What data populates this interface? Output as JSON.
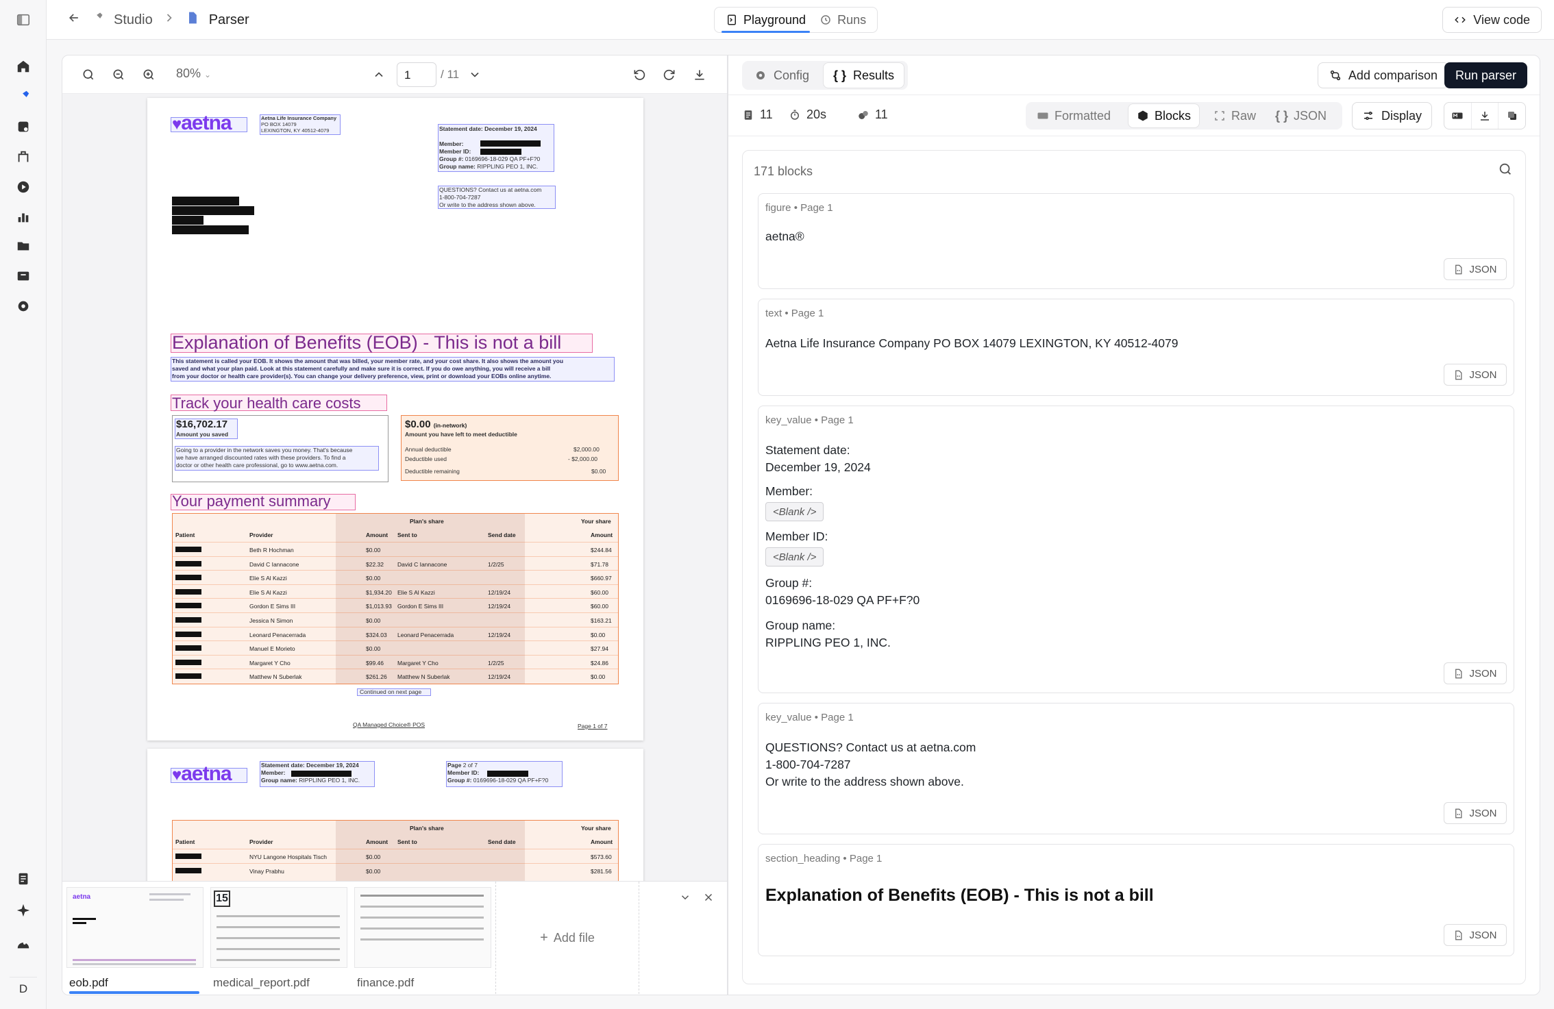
{
  "breadcrumb": {
    "studio": "Studio",
    "parser": "Parser"
  },
  "mode_tabs": {
    "playground": "Playground",
    "runs": "Runs"
  },
  "view_code": "View code",
  "rail": {
    "avatar": "D"
  },
  "doc_toolbar": {
    "zoom": "80%",
    "page_value": "1",
    "page_total": "/ 11"
  },
  "document": {
    "insurer": "Aetna Life Insurance Company",
    "address1": "PO BOX 14079",
    "address2": "LEXINGTON, KY 40512-4079",
    "statement_label": "Statement date:",
    "statement_date": "December 19, 2024",
    "member_label": "Member:",
    "member_id_label": "Member ID:",
    "group_label": "Group #:",
    "group_value": "0169696-18-029 QA PF+F?0",
    "group_name_label": "Group name:",
    "group_name_value": "RIPPLING PEO 1, INC.",
    "questions_1": "QUESTIONS? Contact us at aetna.com",
    "questions_2": "1-800-704-7287",
    "questions_3": "Or write to the address shown above.",
    "eob_title": "Explanation of Benefits (EOB) - This is not a bill",
    "eob_intro_1": "This statement is called your EOB. It shows the amount that was billed, your member rate, and your cost share. It also shows the amount you",
    "eob_intro_2": "saved and what your plan paid. Look at this statement carefully and make sure it is correct. If you do owe anything, you will receive a bill",
    "eob_intro_3": "from your doctor or health care provider(s). You can change your delivery preference, view, print or download your EOBs online anytime.",
    "track_title": "Track your health care costs",
    "saved_amount": "$16,702.17",
    "saved_label": "Amount you saved",
    "saved_note_1": "Going to a provider in the network saves you money. That's because",
    "saved_note_2": "we have arranged discounted rates with these providers. To find a",
    "saved_note_3": "doctor or other health care professional, go to www.aetna.com.",
    "deductible_amount": "$0.00",
    "deductible_in_network": "(in-network)",
    "deductible_label": "Amount you have left to meet deductible",
    "annual_label": "Annual deductible",
    "annual_value": "$2,000.00",
    "used_label": "Deductible used",
    "used_value": "- $2,000.00",
    "remaining_label": "Deductible remaining",
    "remaining_value": "$0.00",
    "payment_title": "Your payment summary",
    "plans_share": "Plan's share",
    "your_share": "Your share",
    "col_patient": "Patient",
    "col_provider": "Provider",
    "col_amount": "Amount",
    "col_sent_to": "Sent to",
    "col_send_date": "Send date",
    "col_amount2": "Amount",
    "rows": [
      {
        "provider": "Beth R Hochman",
        "amount": "$0.00",
        "sent_to": "",
        "send_date": "",
        "your": "$244.84"
      },
      {
        "provider": "David C Iannacone",
        "amount": "$22.32",
        "sent_to": "David C Iannacone",
        "send_date": "1/2/25",
        "your": "$71.78"
      },
      {
        "provider": "Elie S Al Kazzi",
        "amount": "$0.00",
        "sent_to": "",
        "send_date": "",
        "your": "$660.97"
      },
      {
        "provider": "Elie S Al Kazzi",
        "amount": "$1,934.20",
        "sent_to": "Elie S Al Kazzi",
        "send_date": "12/19/24",
        "your": "$60.00"
      },
      {
        "provider": "Gordon E Sims III",
        "amount": "$1,013.93",
        "sent_to": "Gordon E Sims III",
        "send_date": "12/19/24",
        "your": "$60.00"
      },
      {
        "provider": "Jessica N Simon",
        "amount": "$0.00",
        "sent_to": "",
        "send_date": "",
        "your": "$163.21"
      },
      {
        "provider": "Leonard Penacerrada",
        "amount": "$324.03",
        "sent_to": "Leonard Penacerrada",
        "send_date": "12/19/24",
        "your": "$0.00"
      },
      {
        "provider": "Manuel E Morieto",
        "amount": "$0.00",
        "sent_to": "",
        "send_date": "",
        "your": "$27.94"
      },
      {
        "provider": "Margaret Y Cho",
        "amount": "$99.46",
        "sent_to": "Margaret Y Cho",
        "send_date": "1/2/25",
        "your": "$24.86"
      },
      {
        "provider": "Matthew N Suberlak",
        "amount": "$261.26",
        "sent_to": "Matthew N Suberlak",
        "send_date": "12/19/24",
        "your": "$0.00"
      }
    ],
    "continued": "Continued on next page",
    "plan_name": "QA Managed Choice® POS",
    "page_of": "Page 1 of 7",
    "p2_page_label": "Page",
    "p2_page_value": "2 of 7",
    "p2_rows": [
      {
        "provider": "NYU Langone Hospitals Tisch",
        "amount": "$0.00",
        "your": "$573.60"
      },
      {
        "provider": "Vinay Prabhu",
        "amount": "$0.00",
        "your": "$281.56"
      }
    ]
  },
  "logo_text": "aetna",
  "files": [
    {
      "name": "eob.pdf"
    },
    {
      "name": "medical_report.pdf"
    },
    {
      "name": "finance.pdf"
    }
  ],
  "add_file": "Add file",
  "results_tabs": {
    "config": "Config",
    "results": "Results"
  },
  "add_comparison": "Add comparison",
  "run_parser": "Run parser",
  "stats": {
    "pages": "11",
    "time": "20s",
    "credits": "11"
  },
  "format_tabs": {
    "formatted": "Formatted",
    "blocks": "Blocks",
    "raw": "Raw",
    "json": "JSON"
  },
  "display": "Display",
  "block_count": "171 blocks",
  "json_label": "JSON",
  "blank_label": "<Blank />",
  "blocks": [
    {
      "meta": "figure • Page 1",
      "text": "aetna®"
    },
    {
      "meta": "text • Page 1",
      "text": "Aetna Life Insurance Company PO BOX 14079 LEXINGTON, KY 40512-4079"
    },
    {
      "meta": "key_value • Page 1",
      "k1": "Statement date:",
      "v1": "December 19, 2024",
      "k2": "Member:",
      "k3": "Member ID:",
      "k4": "Group #:",
      "v4": "0169696-18-029 QA PF+F?0",
      "k5": "Group name:",
      "v5": "RIPPLING PEO 1, INC."
    },
    {
      "meta": "key_value • Page 1",
      "l1": "QUESTIONS? Contact us at aetna.com",
      "l2": "1-800-704-7287",
      "l3": "Or write to the address shown above."
    },
    {
      "meta": "section_heading • Page 1",
      "text": "Explanation of Benefits (EOB) - This is not a bill"
    }
  ],
  "colors": {
    "accent": "#3b82f6",
    "run_button": "#111827",
    "eob_heading": "#7b2a8c"
  }
}
